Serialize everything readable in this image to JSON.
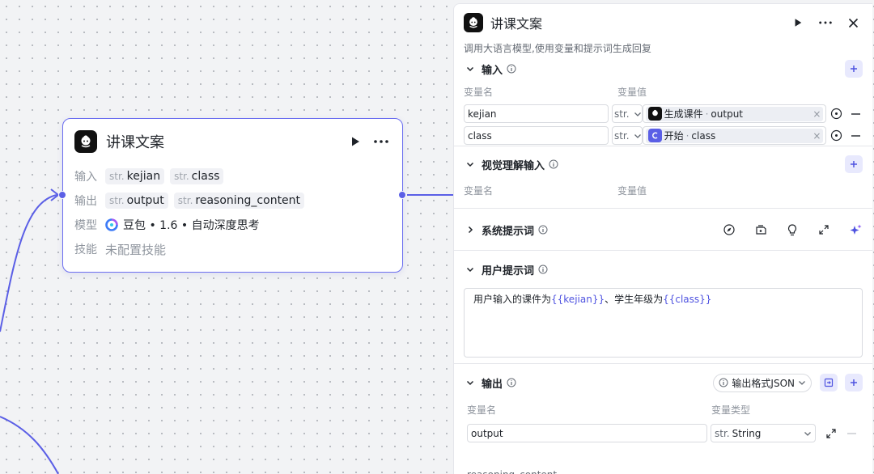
{
  "colors": {
    "accent": "#5b5fe6",
    "link": "#4e52e0",
    "muted": "#8f959e"
  },
  "node": {
    "title": "讲课文案",
    "input_label": "输入",
    "output_label": "输出",
    "model_label": "模型",
    "skills_label": "技能",
    "str_prefix": "str.",
    "inputs": [
      "kejian",
      "class"
    ],
    "outputs": [
      "output",
      "reasoning_content"
    ],
    "model_name": "豆包 • 1.6 • 自动深度思考",
    "skills_value": "未配置技能"
  },
  "panel": {
    "title": "讲课文案",
    "description": "调用大语言模型,使用变量和提示词生成回复",
    "input_section": {
      "title": "输入",
      "col_name": "变量名",
      "col_value": "变量值",
      "rows": [
        {
          "name": "kejian",
          "type": "str.",
          "source": "生成课件",
          "field": "output",
          "source_icon": "bot-logo-icon"
        },
        {
          "name": "class",
          "type": "str.",
          "source": "开始",
          "field": "class",
          "source_icon": "start-icon"
        }
      ]
    },
    "vision_section": {
      "title": "视觉理解输入",
      "col_name": "变量名",
      "col_value": "变量值"
    },
    "system_prompt_section": {
      "title": "系统提示词"
    },
    "user_prompt_section": {
      "title": "用户提示词",
      "text_1": "用户输入的课件为",
      "var_1": "{{kejian}}",
      "text_2": "、学生年级为",
      "var_2": "{{class}}"
    },
    "output_section": {
      "title": "输出",
      "format_label": "输出格式JSON",
      "col_name": "变量名",
      "col_type": "变量类型",
      "rows": [
        {
          "name": "output",
          "type_prefix": "str.",
          "type": "String"
        }
      ],
      "partial_text": "reasoning_content"
    }
  }
}
